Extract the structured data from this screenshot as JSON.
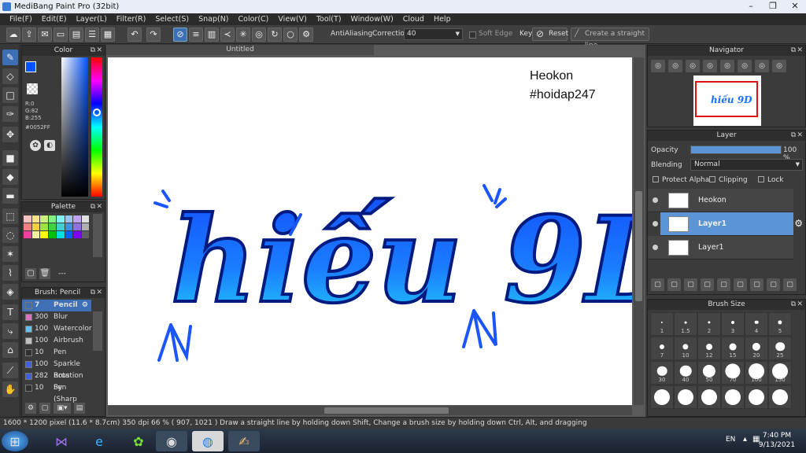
{
  "app": {
    "title": "MediBang Paint Pro (32bit)"
  },
  "menu": [
    "File(F)",
    "Edit(E)",
    "Layer(L)",
    "Filter(R)",
    "Select(S)",
    "Snap(N)",
    "Color(C)",
    "View(V)",
    "Tool(T)",
    "Window(W)",
    "Cloud",
    "Help"
  ],
  "toolbar": {
    "antialias": "AntiAliasing",
    "correction_label": "Correction",
    "correction_value": "40",
    "soft_edge": "Soft Edge",
    "key": "Key",
    "reset": "Reset",
    "straight": "Create a straight line"
  },
  "color_panel": {
    "title": "Color",
    "r": "R:0",
    "g": "G:82",
    "b": "B:255",
    "hex": "#0052FF",
    "fg": "#0052ff",
    "bg": "#000000"
  },
  "palette": {
    "title": "Palette",
    "colors": [
      "#f4c0c0",
      "#f9e08a",
      "#c8f080",
      "#80f080",
      "#80f0f0",
      "#a0c0f0",
      "#c0a0f0",
      "#e0e0e0",
      "#f08080",
      "#f0d040",
      "#a0e040",
      "#40d040",
      "#40d0d0",
      "#4090e0",
      "#9070e0",
      "#b0b0b0",
      "#f040a0",
      "#f0f0a0",
      "#ffff00",
      "#00c000",
      "#00e0e0",
      "#0060ff",
      "#8000ff",
      "#606060"
    ],
    "count": "---"
  },
  "brush_panel": {
    "title": "Brush: Pencil",
    "items": [
      {
        "size": "7",
        "name": "Pencil",
        "color": "#3f6fb5"
      },
      {
        "size": "300",
        "name": "Blur",
        "color": "#e070c0"
      },
      {
        "size": "100",
        "name": "Watercolor",
        "color": "#60c0f0"
      },
      {
        "size": "100",
        "name": "Airbrush",
        "color": "#c0c0c0"
      },
      {
        "size": "10",
        "name": "Pen",
        "color": "#303030"
      },
      {
        "size": "100",
        "name": "Sparkle Brus",
        "color": "#4060e0"
      },
      {
        "size": "282",
        "name": "Rotation Sy",
        "color": "#4060e0"
      },
      {
        "size": "10",
        "name": "Pen (Sharp",
        "color": "#303030"
      }
    ]
  },
  "canvas": {
    "tab": "Untitled",
    "text1": "Heokon",
    "text2": "#hoidap247",
    "art": "hiếu 9D"
  },
  "navigator": {
    "title": "Navigator"
  },
  "layer_panel": {
    "title": "Layer",
    "opacity_label": "Opacity",
    "opacity_value": "100 %",
    "opacity_fraction": 1.0,
    "blending_label": "Blending",
    "blending_value": "Normal",
    "protect": "Protect Alpha",
    "clipping": "Clipping",
    "lock": "Lock",
    "layers": [
      {
        "name": "Heokon"
      },
      {
        "name": "Layer1"
      },
      {
        "name": "Layer1"
      }
    ]
  },
  "brush_size": {
    "title": "Brush Size",
    "sizes": [
      "1",
      "1.5",
      "2",
      "3",
      "4",
      "5",
      "7",
      "10",
      "12",
      "15",
      "20",
      "25",
      "30",
      "40",
      "50",
      "70",
      "100",
      "150"
    ]
  },
  "status": {
    "text": "1600 * 1200 pixel   (11.6 * 8.7cm)   350 dpi   66 %   ( 907, 1021 )   Draw a straight line by holding down Shift, Change a brush size by holding down Ctrl, Alt, and dragging"
  },
  "taskbar": {
    "lang": "EN",
    "time": "7:40 PM",
    "date": "9/13/2021"
  }
}
